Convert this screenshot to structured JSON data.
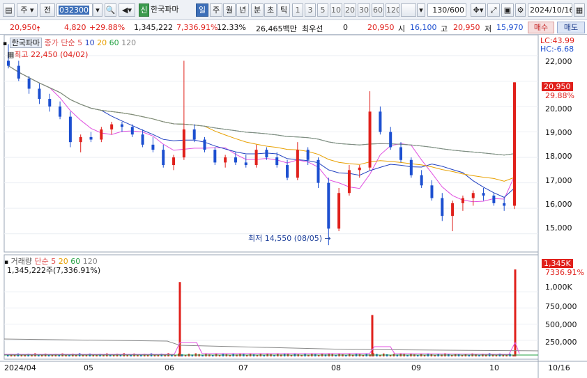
{
  "toolbar": {
    "market": "주",
    "type": "전",
    "code": "032300",
    "sin_badge": "신",
    "stock_name": "한국파마",
    "periods": [
      "일",
      "주",
      "월",
      "년",
      "분",
      "초",
      "틱"
    ],
    "active_period": "일",
    "intervals": [
      "1",
      "3",
      "5",
      "10",
      "20",
      "30",
      "60",
      "120"
    ],
    "count": "130",
    "count_max": "/600",
    "date": "2024/10/16"
  },
  "quote": {
    "price": "20,950",
    "change": "4,820",
    "change_pct": "+29.88%",
    "volume": "1,345,222",
    "volume_ratio": "7,336.91%",
    "turnover": "12.33%",
    "amount": "26,465백만",
    "best_bid_label": "최우선",
    "best_bid_value": "0",
    "current_price": "20,950",
    "open_label": "시",
    "open": "16,100",
    "high_label": "고",
    "high": "20,950",
    "low_label": "저",
    "low": "15,970",
    "buy_button": "매수",
    "sell_button": "매도"
  },
  "price_panel": {
    "name": "한국파마",
    "ma_label": "종가 단순",
    "ma_periods": [
      "5",
      "10",
      "20",
      "60",
      "120"
    ],
    "ma_colors": [
      "#e05050",
      "#2040c0",
      "#e8a000",
      "#20a040",
      "#888888"
    ],
    "high_marker": "최고 22,450 (04/02)",
    "low_marker": "최저 14,550 (08/05)",
    "lc": "LC:43.99",
    "hc": "HC:-6.68",
    "price_ticks": [
      "22,000",
      "21,000",
      "20,000",
      "19,000",
      "18,000",
      "17,000",
      "16,000",
      "15,000"
    ],
    "last_price_tag": "20,950",
    "last_pct_tag": "29.88%"
  },
  "volume_panel": {
    "name": "거래량",
    "ma_label": "단순",
    "ma_periods": [
      "5",
      "20",
      "60",
      "120"
    ],
    "current_volume": "1,345,222주(7,336.91%)",
    "volume_ticks": [
      "1,000K",
      "750,000",
      "500,000",
      "250,000"
    ],
    "last_volume_tag": "1,345K",
    "last_pct_tag": "7336.91%"
  },
  "x_axis": {
    "labels": [
      "2024/04",
      "05",
      "06",
      "07",
      "08",
      "09",
      "10"
    ],
    "right_label": "10/16"
  },
  "colors": {
    "up": "#e0201b",
    "down": "#1c4fd0",
    "accent": "#3d6fb8"
  },
  "chart_data": {
    "type": "candlestick",
    "title": "",
    "x_range": [
      "2024-04",
      "2024-10-16"
    ],
    "y_range": [
      14500,
      22600
    ],
    "price_ohlc_approx": [
      [
        21800,
        22450,
        21500,
        21600
      ],
      [
        21600,
        21800,
        21000,
        21100
      ],
      [
        21100,
        21200,
        20500,
        20700
      ],
      [
        20700,
        20900,
        20100,
        20300
      ],
      [
        20300,
        20500,
        19800,
        20000
      ],
      [
        20000,
        20200,
        19500,
        19600
      ],
      [
        19600,
        19800,
        18400,
        18600
      ],
      [
        18600,
        18900,
        18200,
        18800
      ],
      [
        18800,
        19000,
        18600,
        18700
      ],
      [
        18700,
        19200,
        18600,
        19100
      ],
      [
        19100,
        19400,
        18900,
        19300
      ],
      [
        19300,
        19400,
        19000,
        19200
      ],
      [
        19200,
        19300,
        18800,
        18900
      ],
      [
        18900,
        19100,
        18400,
        18500
      ],
      [
        18500,
        18800,
        18200,
        18300
      ],
      [
        18300,
        18500,
        17600,
        17700
      ],
      [
        17700,
        18100,
        17500,
        18000
      ],
      [
        18000,
        21800,
        17900,
        19100
      ],
      [
        19100,
        19300,
        18600,
        18700
      ],
      [
        18700,
        18800,
        18200,
        18300
      ],
      [
        18300,
        18400,
        17700,
        17800
      ],
      [
        17800,
        18100,
        17600,
        18000
      ],
      [
        18000,
        18200,
        17700,
        17800
      ],
      [
        17800,
        18100,
        17600,
        17700
      ],
      [
        17700,
        18500,
        17600,
        18300
      ],
      [
        18300,
        18400,
        17900,
        18000
      ],
      [
        18000,
        18200,
        17600,
        17700
      ],
      [
        17700,
        17900,
        17100,
        17200
      ],
      [
        17200,
        18600,
        17100,
        18300
      ],
      [
        18300,
        18400,
        17700,
        17900
      ],
      [
        17900,
        18000,
        16800,
        17000
      ],
      [
        17000,
        17200,
        14550,
        15200
      ],
      [
        15200,
        16800,
        15100,
        16600
      ],
      [
        16600,
        17700,
        16500,
        17500
      ],
      [
        17500,
        17700,
        17200,
        17600
      ],
      [
        17600,
        20600,
        17500,
        19800
      ],
      [
        19800,
        20000,
        18900,
        19000
      ],
      [
        19000,
        19200,
        18300,
        18400
      ],
      [
        18400,
        18600,
        17800,
        17900
      ],
      [
        17900,
        18000,
        17200,
        17300
      ],
      [
        17300,
        17500,
        16800,
        16900
      ],
      [
        16900,
        17100,
        16300,
        16400
      ],
      [
        16400,
        16600,
        15500,
        15700
      ],
      [
        15700,
        16300,
        15100,
        16200
      ],
      [
        16200,
        16500,
        15900,
        16400
      ],
      [
        16400,
        16700,
        16100,
        16600
      ],
      [
        16600,
        16800,
        16300,
        16500
      ],
      [
        16500,
        16600,
        16100,
        16200
      ],
      [
        16200,
        16400,
        15900,
        16100
      ],
      [
        16100,
        20950,
        15970,
        20950
      ]
    ],
    "volume_peaks_approx": [
      {
        "date": "06",
        "volume": 1150000
      },
      {
        "date": "08",
        "volume": 640000
      },
      {
        "date": "10/16",
        "volume": 1345222
      }
    ]
  }
}
